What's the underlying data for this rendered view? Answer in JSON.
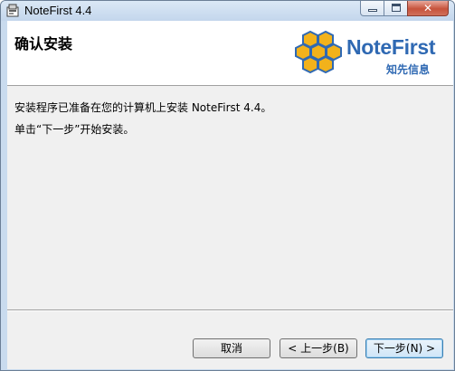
{
  "window": {
    "title": "NoteFirst 4.4",
    "controls": {
      "minimize": "minimize-icon",
      "maximize": "maximize-icon",
      "close": "close-icon"
    }
  },
  "header": {
    "title": "确认安装",
    "logo": {
      "name": "NoteFirst",
      "subtitle": "知先信息"
    }
  },
  "body": {
    "line1": "安装程序已准备在您的计算机上安装 NoteFirst 4.4。",
    "line2": "单击“下一步”开始安装。"
  },
  "buttons": {
    "cancel": "取消",
    "back": "< 上一步(B)",
    "next": "下一步(N) >"
  },
  "colors": {
    "brand": "#2f69b3",
    "honeycomb": "#f2b21b",
    "close_button": "#c7533c"
  }
}
